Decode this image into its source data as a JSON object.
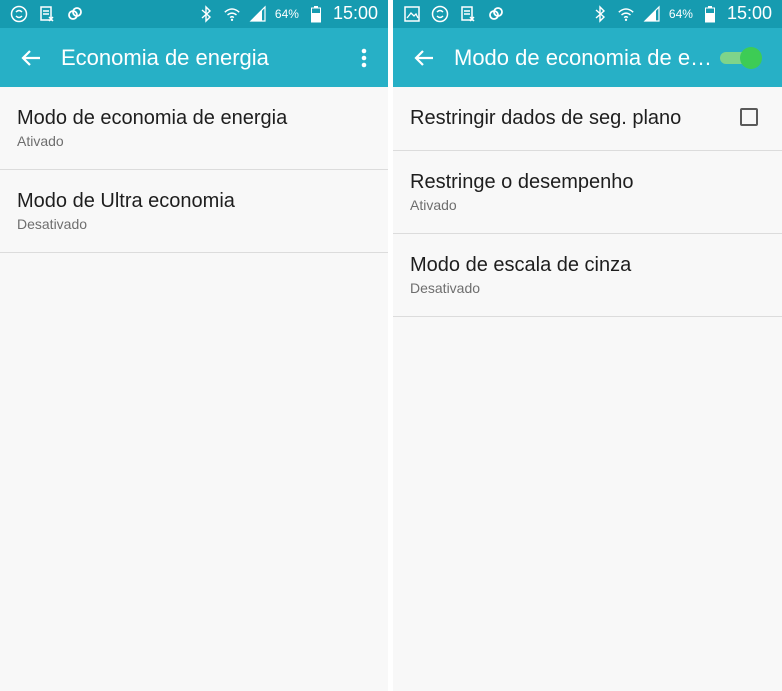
{
  "status_bar": {
    "battery_percent": "64%",
    "time": "15:00"
  },
  "left": {
    "title": "Economia de energia",
    "items": [
      {
        "title": "Modo de economia de energia",
        "subtitle": "Ativado"
      },
      {
        "title": "Modo de Ultra economia",
        "subtitle": "Desativado"
      }
    ]
  },
  "right": {
    "title": "Modo de economia de e…",
    "master_switch_on": true,
    "items": [
      {
        "title": "Restringir dados de seg. plano",
        "checked": false
      },
      {
        "title": "Restringe o desempenho",
        "subtitle": "Ativado"
      },
      {
        "title": "Modo de escala de cinza",
        "subtitle": "Desativado"
      }
    ]
  },
  "colors": {
    "status_bar": "#169bb0",
    "app_bar": "#27b0c6",
    "switch_on": "#3dcc55"
  }
}
